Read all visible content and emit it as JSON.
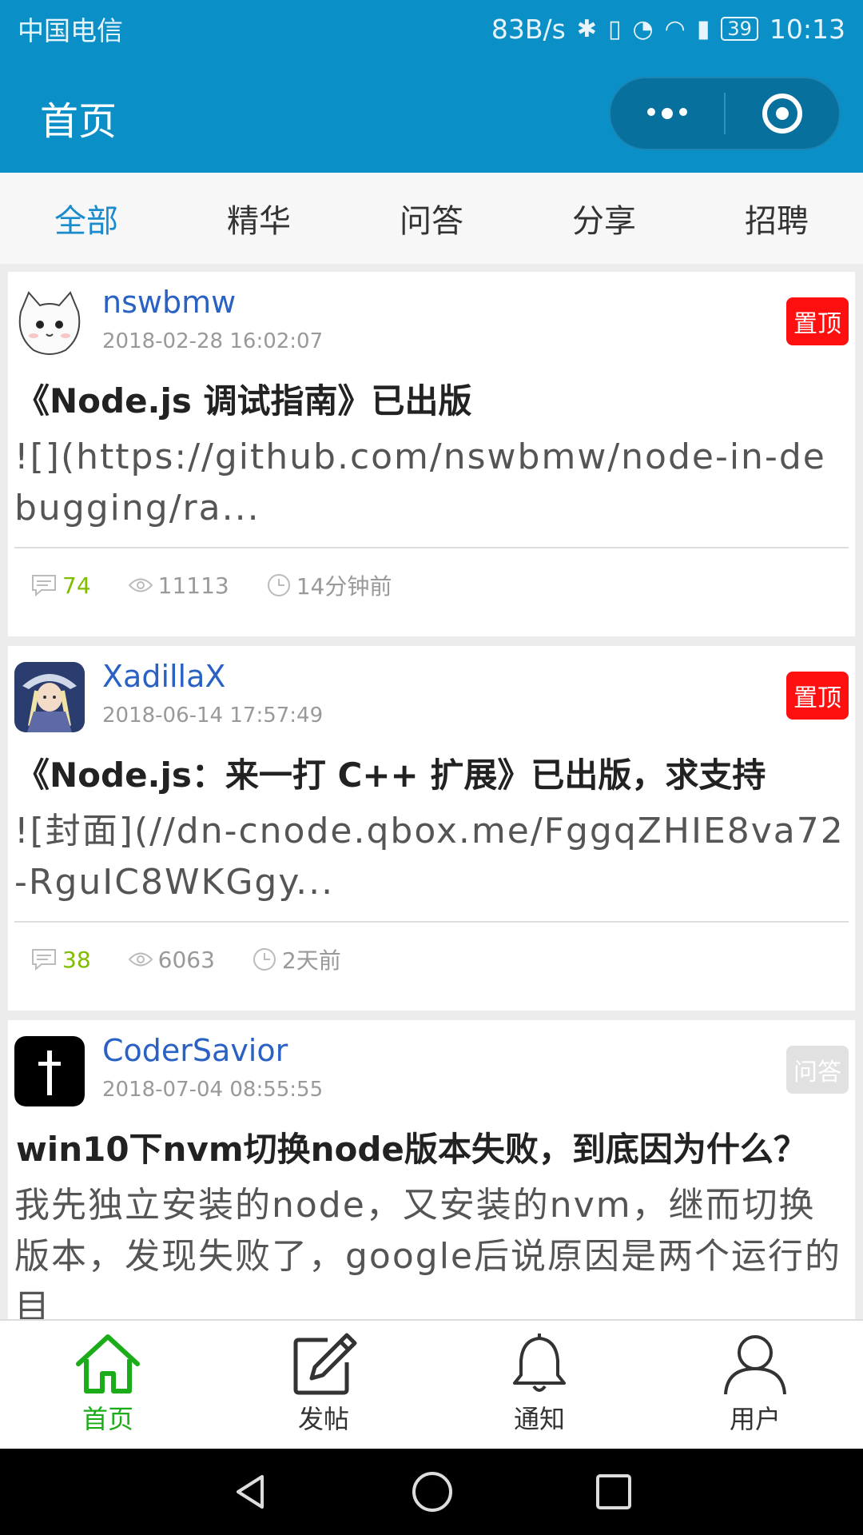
{
  "status_bar": {
    "carrier": "中国电信",
    "speed": "83B/s",
    "battery": "39",
    "time": "10:13"
  },
  "nav": {
    "title": "首页"
  },
  "tabs": [
    {
      "label": "全部",
      "active": true
    },
    {
      "label": "精华",
      "active": false
    },
    {
      "label": "问答",
      "active": false
    },
    {
      "label": "分享",
      "active": false
    },
    {
      "label": "招聘",
      "active": false
    }
  ],
  "posts": [
    {
      "author": "nswbmw",
      "date": "2018-02-28 16:02:07",
      "badge": "置顶",
      "title": "《Node.js 调试指南》已出版",
      "excerpt": "![](https://github.com/nswbmw/node-in-debugging/ra...",
      "replies": "74",
      "views": "11113",
      "time_ago": "14分钟前"
    },
    {
      "author": "XadillaX",
      "date": "2018-06-14 17:57:49",
      "badge": "置顶",
      "title": "《Node.js：来一打 C++ 扩展》已出版，求支持",
      "excerpt": "![封面](//dn-cnode.qbox.me/FggqZHIE8va72-RguIC8WKGgy...",
      "replies": "38",
      "views": "6063",
      "time_ago": "2天前"
    },
    {
      "author": "CoderSavior",
      "date": "2018-07-04 08:55:55",
      "badge": "问答",
      "title": "win10下nvm切换node版本失败，到底因为什么？",
      "excerpt": "我先独立安装的node，又安装的nvm，继而切换版本，发现失败了，google后说原因是两个运行的目"
    }
  ],
  "tabbar": [
    {
      "label": "首页",
      "icon": "home-icon",
      "active": true
    },
    {
      "label": "发帖",
      "icon": "edit-icon",
      "active": false
    },
    {
      "label": "通知",
      "icon": "bell-icon",
      "active": false
    },
    {
      "label": "用户",
      "icon": "user-icon",
      "active": false
    }
  ],
  "colors": {
    "primary": "#0b8fc7",
    "active_tab": "#1a8ccd",
    "pin_badge": "#ff1010",
    "reply_count": "#80bd01",
    "tabbar_active": "#1aad19"
  }
}
